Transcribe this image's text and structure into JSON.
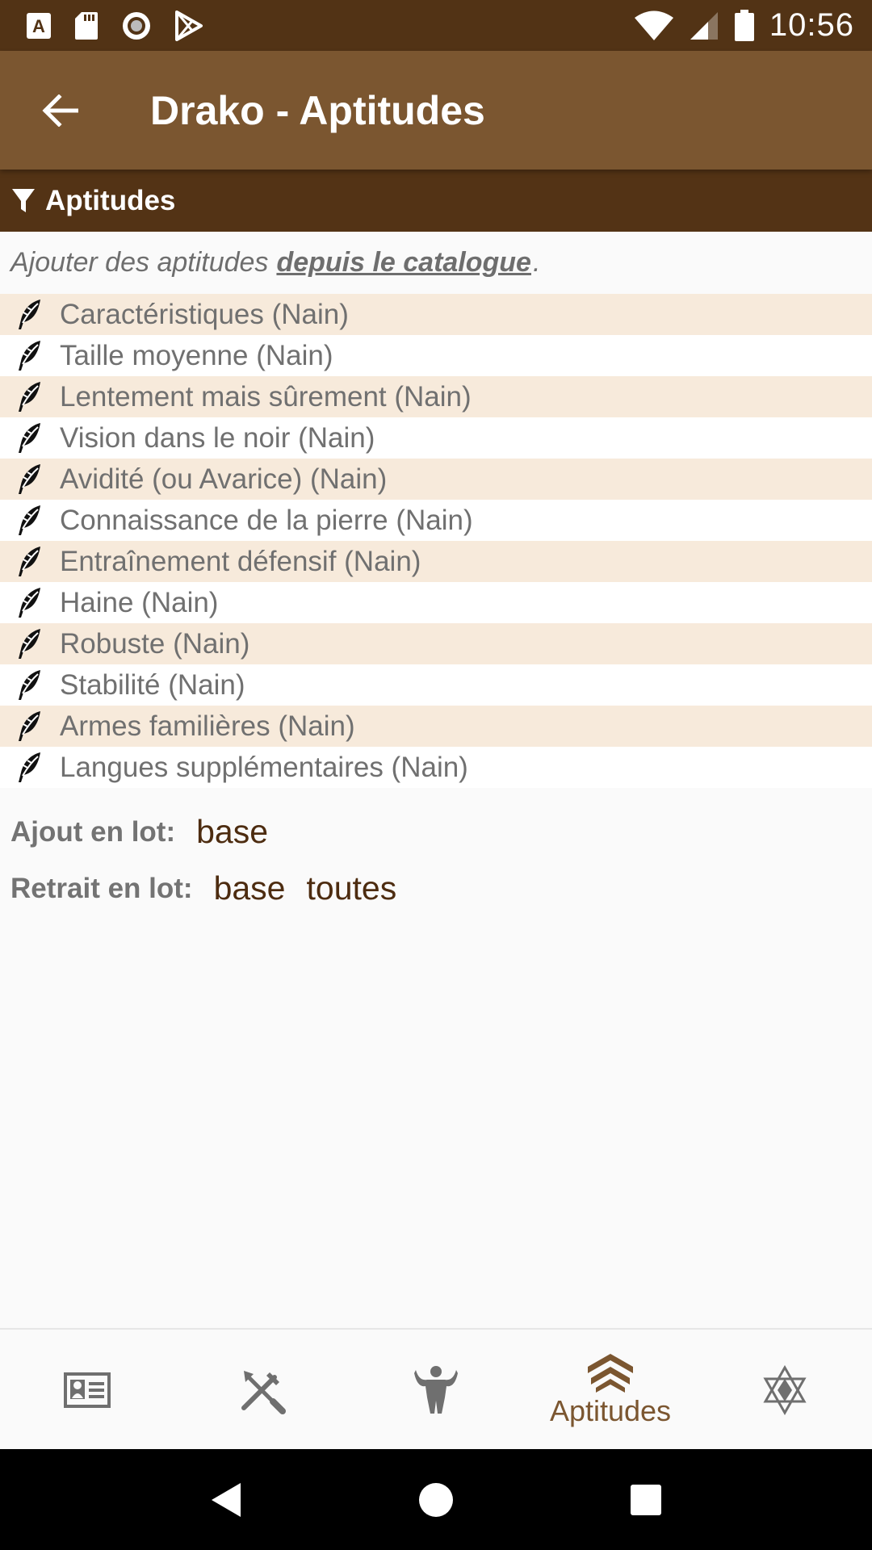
{
  "status_bar": {
    "time": "10:56",
    "left_icons": [
      "font-a-icon",
      "sd-card-icon",
      "record-icon",
      "play-store-icon"
    ],
    "right_icons": [
      "wifi-icon",
      "cell-signal-icon",
      "battery-icon"
    ]
  },
  "appbar": {
    "title": "Drako - Aptitudes",
    "back_icon": "arrow-back-icon"
  },
  "section": {
    "title": "Aptitudes",
    "icon": "filter-icon"
  },
  "catalogue": {
    "prefix": "Ajouter des aptitudes",
    "link": "depuis le catalogue",
    "suffix": "."
  },
  "abilities": [
    {
      "label": "Caractéristiques (Nain)"
    },
    {
      "label": "Taille moyenne (Nain)"
    },
    {
      "label": "Lentement mais sûrement (Nain)"
    },
    {
      "label": "Vision dans le noir (Nain)"
    },
    {
      "label": "Avidité (ou Avarice) (Nain)"
    },
    {
      "label": "Connaissance de la pierre (Nain)"
    },
    {
      "label": "Entraînement défensif (Nain)"
    },
    {
      "label": "Haine (Nain)"
    },
    {
      "label": "Robuste (Nain)"
    },
    {
      "label": "Stabilité (Nain)"
    },
    {
      "label": "Armes familières (Nain)"
    },
    {
      "label": "Langues supplémentaires (Nain)"
    }
  ],
  "batch_add": {
    "label": "Ajout en lot:",
    "options": [
      "base"
    ]
  },
  "batch_remove": {
    "label": "Retrait en lot:",
    "options": [
      "base",
      "toutes"
    ]
  },
  "bottom_nav": {
    "items": [
      {
        "icon": "id-card-icon",
        "label": ""
      },
      {
        "icon": "crossed-tools-icon",
        "label": ""
      },
      {
        "icon": "strongman-icon",
        "label": ""
      },
      {
        "icon": "chevrons-up-icon",
        "label": "Aptitudes",
        "active": true
      },
      {
        "icon": "star-of-david-icon",
        "label": ""
      }
    ],
    "active_color": "#7b5630",
    "inactive_color": "#6f6f6f"
  },
  "colors": {
    "status_bar": "#523315",
    "app_bar": "#7b5630",
    "section_header": "#533315",
    "row_alt": "#f7eadb"
  }
}
